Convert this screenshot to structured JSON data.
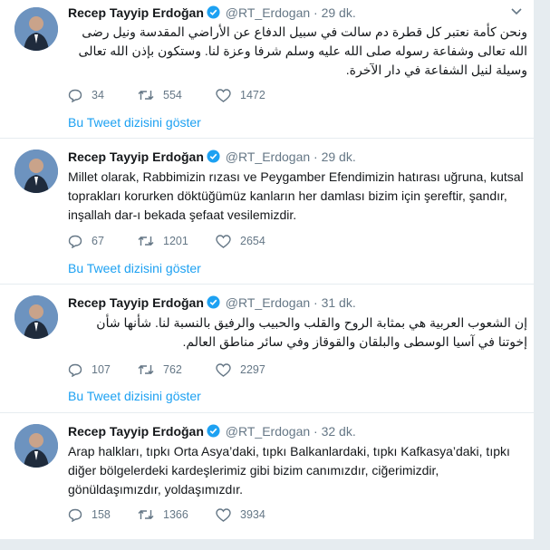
{
  "tweets": [
    {
      "name": "Recep Tayyip Erdoğan",
      "handle": "@RT_Erdogan",
      "dot": "·",
      "time": "29 dk.",
      "text": "ونحن كأمة نعتبر كل قطرة دم سالت في سبيل الدفاع عن الأراضي المقدسة ونيل رضى الله تعالى وشفاعة رسوله صلى الله عليه وسلم شرفا وعزة لنا. وستكون بإذن الله تعالى وسيلة لنيل الشفاعة في دار الآخرة.",
      "direction": "rtl",
      "replies": "34",
      "retweets": "554",
      "likes": "1472",
      "thread_link": "Bu Tweet dizisini göster"
    },
    {
      "name": "Recep Tayyip Erdoğan",
      "handle": "@RT_Erdogan",
      "dot": "·",
      "time": "29 dk.",
      "text": "Millet olarak, Rabbimizin rızası ve Peygamber Efendimizin hatırası uğruna, kutsal toprakları korurken döktüğümüz kanların her damlası bizim için şereftir, şandır, inşallah dar-ı bekada şefaat vesilemizdir.",
      "direction": "ltr",
      "replies": "67",
      "retweets": "1201",
      "likes": "2654",
      "thread_link": "Bu Tweet dizisini göster"
    },
    {
      "name": "Recep Tayyip Erdoğan",
      "handle": "@RT_Erdogan",
      "dot": "·",
      "time": "31 dk.",
      "text": "إن الشعوب العربية هي بمثابة الروح والقلب والحبيب والرفيق بالنسبة لنا. شأنها شأن إخوتنا في آسيا الوسطى والبلقان والقوقاز وفي سائر مناطق العالم.",
      "direction": "rtl",
      "replies": "107",
      "retweets": "762",
      "likes": "2297",
      "thread_link": "Bu Tweet dizisini göster"
    },
    {
      "name": "Recep Tayyip Erdoğan",
      "handle": "@RT_Erdogan",
      "dot": "·",
      "time": "32 dk.",
      "text": "Arap halkları, tıpkı Orta Asya’daki, tıpkı Balkanlardaki, tıpkı Kafkasya’daki, tıpkı diğer bölgelerdeki kardeşlerimiz gibi bizim canımızdır, ciğerimizdir, gönüldaşımızdır, yoldaşımızdır.",
      "direction": "ltr",
      "replies": "158",
      "retweets": "1366",
      "likes": "3934"
    }
  ],
  "colors": {
    "link": "#1da1f2",
    "meta": "#657786",
    "text": "#14171a",
    "verified": "#1da1f2"
  },
  "icons": {
    "reply": "reply-icon",
    "retweet": "retweet-icon",
    "like": "heart-icon",
    "verified": "verified-badge-icon",
    "menu": "chevron-down-icon"
  }
}
